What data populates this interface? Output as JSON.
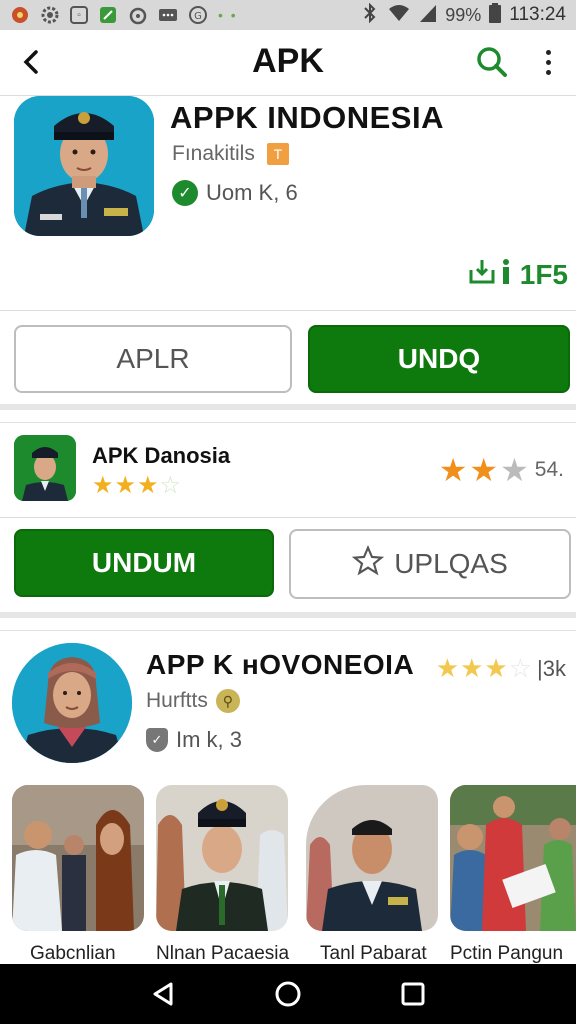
{
  "status_bar": {
    "battery": "99%",
    "time": "113:24",
    "left_icons": [
      "settings-icon",
      "gear-icon",
      "square-icon",
      "leaf-icon",
      "camera-icon",
      "message-icon",
      "shield-icon"
    ],
    "right_icons": [
      "bluetooth-icon",
      "wifi-icon",
      "signal-icon",
      "battery-icon"
    ]
  },
  "app_bar": {
    "title": "APK",
    "back_icon": "back-arrow-icon",
    "search_icon": "search-icon",
    "more_icon": "more-vert-icon"
  },
  "card1": {
    "title": "APPK INDONESIA",
    "subtitle": "Fınakitils",
    "verified_text": "Uom K, 6",
    "stat": "1F5",
    "buttons": {
      "outline": "APLR",
      "primary": "UNDQ"
    }
  },
  "card2": {
    "title": "APK Danosia",
    "rating_count": "54.",
    "buttons": {
      "primary": "UNDUM",
      "outline": "UPLQAS"
    }
  },
  "card3": {
    "title": "APP K ʜOVONEOIA",
    "rating_count": "|3k",
    "subtitle": "Hurftts",
    "verified_text": "Im k, 3",
    "thumbnails": [
      {
        "label": "Gabcnlian"
      },
      {
        "label": "Nlnan Pacaesia"
      },
      {
        "label": "Tanl Pabarat"
      },
      {
        "label": "Pctin Pangun"
      }
    ]
  },
  "colors": {
    "accent_green": "#0e7a0e",
    "star_orange": "#f0901a",
    "star_yellow": "#f2b01e",
    "avatar_blue": "#1aa3c8"
  },
  "nav_bar": {
    "icons": [
      "back-triangle-icon",
      "home-circle-icon",
      "recents-square-icon"
    ]
  }
}
